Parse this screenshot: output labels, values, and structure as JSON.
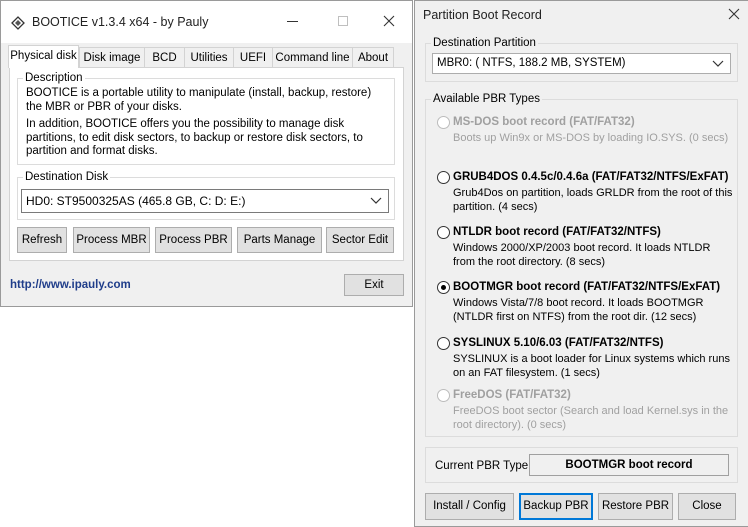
{
  "bootice": {
    "title": "BOOTICE v1.3.4 x64 - by Pauly",
    "tabs": [
      "Physical disk",
      "Disk image",
      "BCD",
      "Utilities",
      "UEFI",
      "Command line",
      "About"
    ],
    "description_label": "Description",
    "description_p1": "BOOTICE is a portable utility to manipulate (install, backup, restore) the MBR or PBR of your disks.",
    "description_p2": "In addition, BOOTICE offers you the possibility to manage disk partitions, to edit disk sectors, to backup or restore disk sectors, to partition and format disks.",
    "destination_label": "Destination Disk",
    "destination_value": "HD0: ST9500325AS (465.8 GB, C: D: E:)",
    "buttons": [
      "Refresh",
      "Process MBR",
      "Process PBR",
      "Parts Manage",
      "Sector Edit"
    ],
    "link": "http://www.ipauly.com",
    "exit_label": "Exit"
  },
  "pbr": {
    "title": "Partition Boot Record",
    "close_glyph": "✕",
    "destination_label": "Destination Partition",
    "destination_value": "MBR0: ( NTFS, 188.2 MB, SYSTEM)",
    "types_label": "Available PBR Types",
    "options": [
      {
        "title": "MS-DOS boot record (FAT/FAT32)",
        "desc": "Boots up Win9x or MS-DOS by loading IO.SYS. (0 secs)",
        "enabled": false,
        "selected": false
      },
      {
        "title": "GRUB4DOS 0.4.5c/0.4.6a (FAT/FAT32/NTFS/ExFAT)",
        "desc": "Grub4Dos on partition, loads GRLDR from the root of this partition. (4 secs)",
        "enabled": true,
        "selected": false
      },
      {
        "title": "NTLDR boot record (FAT/FAT32/NTFS)",
        "desc": "Windows 2000/XP/2003 boot record. It loads NTLDR from the root directory. (8 secs)",
        "enabled": true,
        "selected": false
      },
      {
        "title": "BOOTMGR boot record (FAT/FAT32/NTFS/ExFAT)",
        "desc": "Windows Vista/7/8 boot record. It loads BOOTMGR (NTLDR first on NTFS) from the root dir. (12 secs)",
        "enabled": true,
        "selected": true
      },
      {
        "title": "SYSLINUX 5.10/6.03 (FAT/FAT32/NTFS)",
        "desc": "SYSLINUX is a boot loader for Linux systems which runs on an FAT filesystem. (1 secs)",
        "enabled": true,
        "selected": false
      },
      {
        "title": "FreeDOS (FAT/FAT32)",
        "desc": "FreeDOS boot sector (Search and load Kernel.sys in the root directory). (0 secs)",
        "enabled": false,
        "selected": false
      }
    ],
    "current_label": "Current PBR Type:",
    "current_value": "BOOTMGR boot record",
    "buttons": [
      "Install / Config",
      "Backup PBR",
      "Restore PBR",
      "Close"
    ]
  }
}
